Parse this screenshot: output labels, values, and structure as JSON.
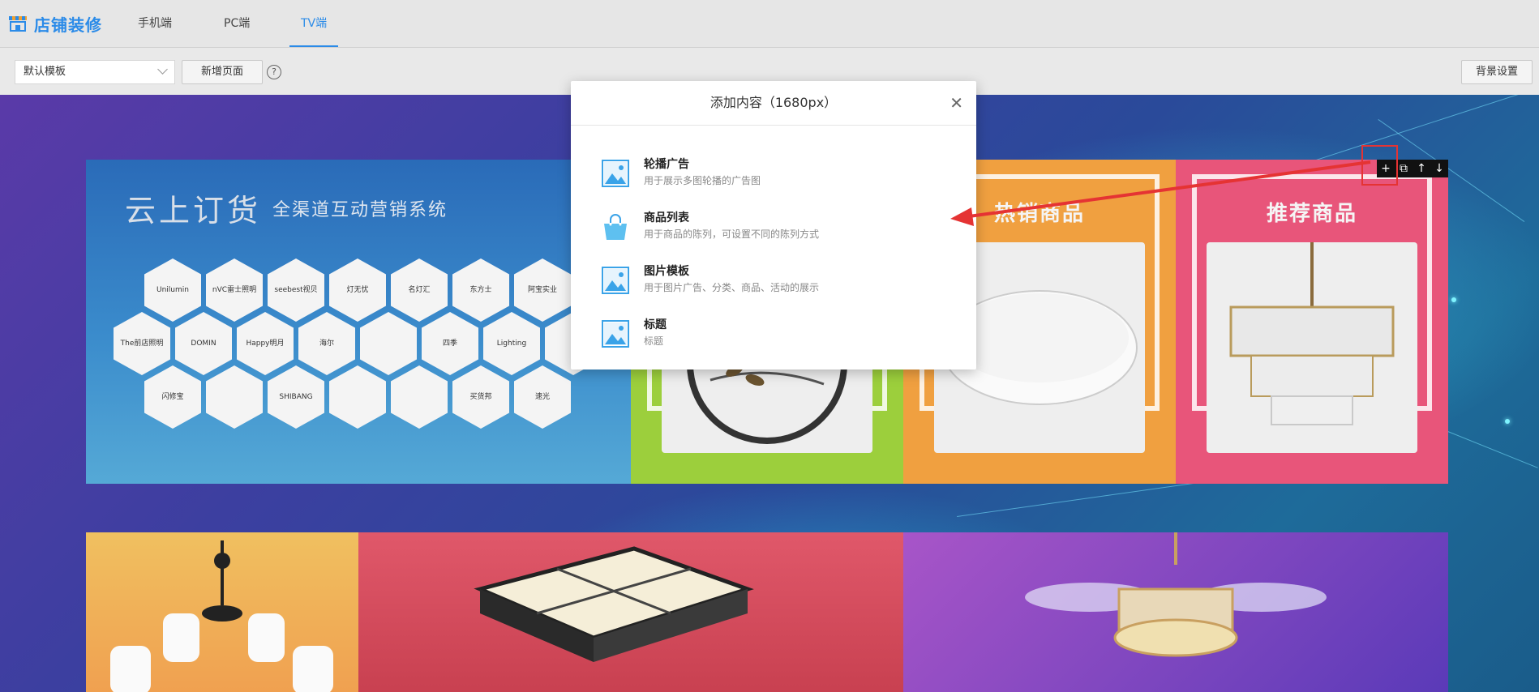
{
  "header": {
    "brand_title": "店铺装修",
    "tabs": [
      {
        "label": "手机端"
      },
      {
        "label": "PC端"
      },
      {
        "label": "TV端"
      }
    ]
  },
  "toolbar": {
    "template_select_value": "默认模板",
    "add_page_label": "新增页面",
    "help_symbol": "?",
    "bg_settings_label": "背景设置"
  },
  "canvas": {
    "brand_panel": {
      "title": "云上订货",
      "subtitle": "全渠道互动营销系统",
      "logos": [
        "Unilumin",
        "nVC雷士照明",
        "seebest视贝",
        "灯无忧",
        "名灯汇",
        "东方士",
        "阿宝实业",
        "The前店照明",
        "DOMIN",
        "Happy明月",
        "海尔",
        "",
        "四季",
        "Lighting",
        "",
        "闪修宝",
        "",
        "SHIBANG",
        "",
        "",
        "买货邦",
        "速光"
      ]
    },
    "categories": [
      {
        "title": ""
      },
      {
        "title": "热销商品"
      },
      {
        "title": "推荐商品"
      }
    ],
    "element_toolbar": [
      "+",
      "⧉",
      "↑",
      "↓"
    ]
  },
  "modal": {
    "title": "添加内容（1680px）",
    "close_symbol": "✕",
    "options": [
      {
        "name": "轮播广告",
        "desc": "用于展示多图轮播的广告图",
        "icon": "image-icon"
      },
      {
        "name": "商品列表",
        "desc": "用于商品的陈列，可设置不同的陈列方式",
        "icon": "shopping-bag-icon"
      },
      {
        "name": "图片模板",
        "desc": "用于图片广告、分类、商品、活动的展示",
        "icon": "image-icon"
      },
      {
        "name": "标题",
        "desc": "标题",
        "icon": "image-icon"
      }
    ]
  },
  "colors": {
    "accent": "#2b8be8",
    "annotation_red": "#e53333",
    "category_green": "#9ccf3c",
    "category_orange": "#f0a040",
    "category_pink": "#e8557a"
  }
}
